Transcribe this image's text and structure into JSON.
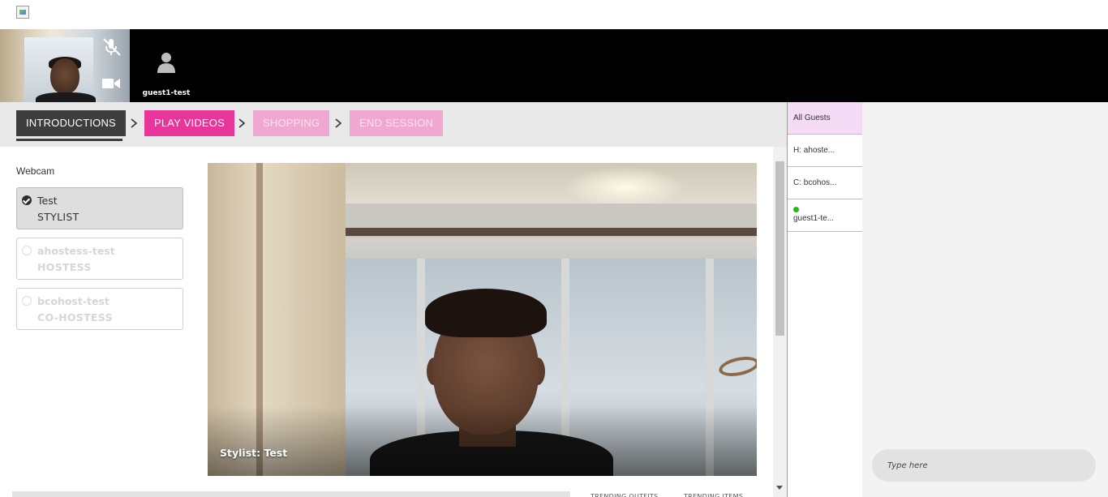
{
  "participants": {
    "guest_name": "guest1-test"
  },
  "steps": [
    {
      "label": "INTRODUCTIONS",
      "state": "current"
    },
    {
      "label": "PLAY VIDEOS",
      "state": "active"
    },
    {
      "label": "SHOPPING",
      "state": "disabled"
    },
    {
      "label": "END SESSION",
      "state": "disabled"
    }
  ],
  "webcam": {
    "label": "Webcam",
    "options": [
      {
        "name": "Test",
        "role": "STYLIST",
        "selected": true
      },
      {
        "name": "ahostess-test",
        "role": "HOSTESS",
        "selected": false
      },
      {
        "name": "bcohost-test",
        "role": "CO-HOSTESS",
        "selected": false
      }
    ]
  },
  "video": {
    "caption": "Stylist: Test"
  },
  "bottom_tabs": [
    "TRENDING OUTFITS",
    "TRENDING ITEMS"
  ],
  "guests": [
    {
      "label": "All Guests",
      "active": true,
      "online": false
    },
    {
      "label": "H: ahoste...",
      "active": false,
      "online": false
    },
    {
      "label": "C: bcohos...",
      "active": false,
      "online": false
    },
    {
      "label": "guest1-te...",
      "active": false,
      "online": true
    }
  ],
  "chat": {
    "placeholder": "Type here"
  },
  "colors": {
    "accent_pink": "#e8359a",
    "accent_pink_light": "#f0a8d0",
    "step_current": "#3d3d3d",
    "online_green": "#1db91d",
    "guest_active_bg": "#f4dcf6"
  },
  "icons": {
    "logo": "broken-image-icon",
    "mic": "mic-off-icon",
    "camera": "video-camera-icon",
    "guest": "person-icon",
    "step_separator": "chevron-right-icon",
    "webcam_selected": "check-circle-icon",
    "webcam_unselected": "radio-empty-icon"
  }
}
